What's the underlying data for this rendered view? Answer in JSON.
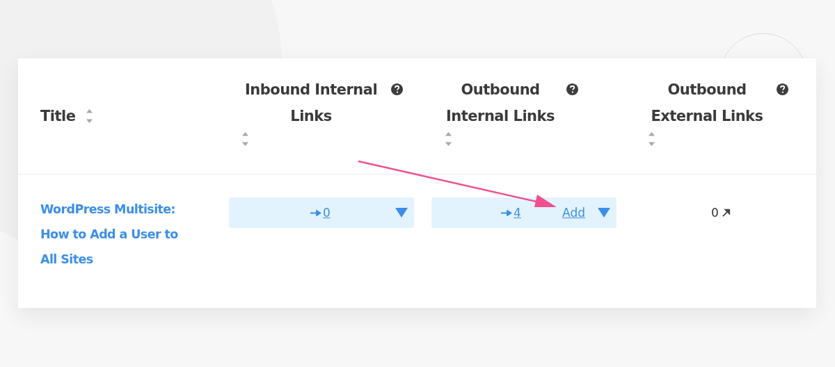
{
  "table": {
    "columns": [
      {
        "label": "Title",
        "help": false
      },
      {
        "label": "Inbound Internal Links",
        "help": true
      },
      {
        "label": "Outbound Internal Links",
        "help": true
      },
      {
        "label": "Outbound External Links",
        "help": true
      }
    ],
    "rows": [
      {
        "title": "WordPress Multisite: How to Add a User to All Sites",
        "inbound": {
          "count": "0"
        },
        "outbound": {
          "count": "4",
          "action": "Add"
        },
        "external": {
          "count": "0"
        }
      }
    ]
  },
  "annotation": {
    "kind": "arrow"
  }
}
